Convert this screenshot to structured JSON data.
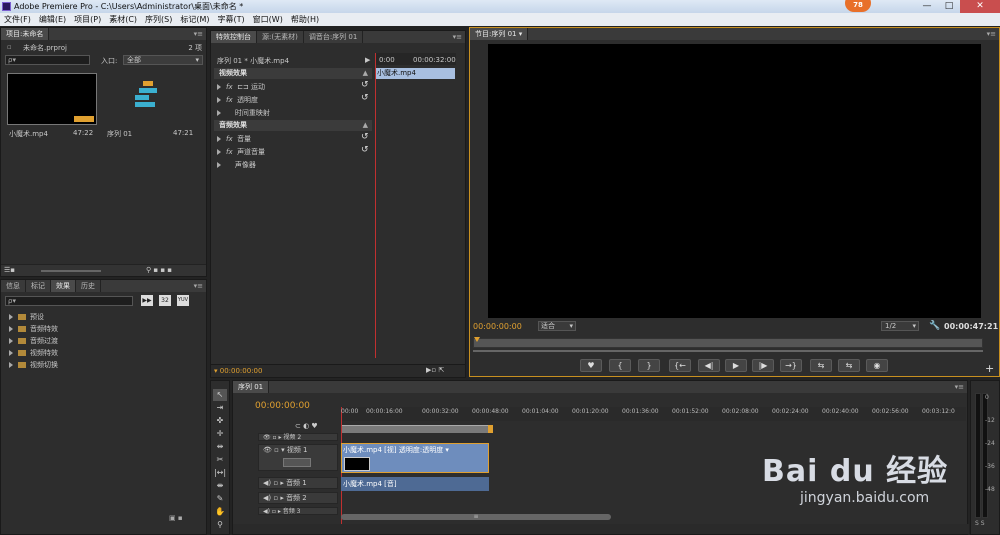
{
  "window": {
    "title": "Adobe Premiere Pro - C:\\Users\\Administrator\\桌面\\未命名 *",
    "badge": "78",
    "minimize": "—",
    "maximize": "□",
    "close": "✕"
  },
  "menu": [
    "文件(F)",
    "编辑(E)",
    "项目(P)",
    "素材(C)",
    "序列(S)",
    "标记(M)",
    "字幕(T)",
    "窗口(W)",
    "帮助(H)"
  ],
  "project": {
    "tab": "项目:未命名",
    "file": "未命名.prproj",
    "count": "2 项",
    "search_prefix": "ρ▾",
    "in_label": "入口:",
    "in_value": "全部",
    "items": [
      {
        "name": "小魔术.mp4",
        "duration": "47:22"
      },
      {
        "name": "序列 01",
        "duration": "47:21"
      }
    ]
  },
  "effects_panel": {
    "tabs": [
      "信息",
      "标记",
      "效果",
      "历史"
    ],
    "btn_32": "32",
    "btn_yuv": "YUV",
    "items": [
      "预设",
      "音频特效",
      "音频过渡",
      "视频特效",
      "视频切换"
    ]
  },
  "effect_controls": {
    "tabs": [
      "特效控制台",
      "源:(无素材)",
      "调音台:序列 01"
    ],
    "sequence": "序列 01 * 小魔术.mp4",
    "time_start": "0:00",
    "time_end": "00:00:32:00",
    "clip": "小魔术.mp4",
    "video_header": "视频效果",
    "video_items": [
      "运动",
      "透明度",
      "时间重映射"
    ],
    "audio_header": "音频效果",
    "audio_items": [
      "音量",
      "声道音量",
      "声像器"
    ],
    "timecode": "00:00:00:00",
    "fx": "fx",
    "reset_glyph": "↺"
  },
  "program": {
    "tab": "节目:序列 01",
    "timecode": "00:00:00:00",
    "fit": "适合",
    "quality": "1/2",
    "duration": "00:00:47:21",
    "controls": [
      "♥",
      "{",
      "}",
      "{←",
      "◀|",
      "▶",
      "|▶",
      "→}",
      "⇆",
      "⇆",
      "◉"
    ],
    "add": "+"
  },
  "timeline": {
    "tab": "序列 01",
    "timecode": "00:00:00:00",
    "ruler": [
      "00:00",
      "00:00:16:00",
      "00:00:32:00",
      "00:00:48:00",
      "00:01:04:00",
      "00:01:20:00",
      "00:01:36:00",
      "00:01:52:00",
      "00:02:08:00",
      "00:02:24:00",
      "00:02:40:00",
      "00:02:56:00",
      "00:03:12:0"
    ],
    "tracks": [
      {
        "label": "视频 2",
        "icons": "👁 ▫"
      },
      {
        "label": "视频 1",
        "icons": "👁 ▫"
      },
      {
        "label": "音频 1",
        "icons": "◀) ▫"
      },
      {
        "label": "音频 2",
        "icons": "◀) ▫"
      },
      {
        "label": "音频 3",
        "icons": "◀) ▫"
      }
    ],
    "video_clip": "小魔术.mp4 [视] 透明度:透明度 ▾",
    "audio_clip": "小魔术.mp4 [音]",
    "scroll": "≡"
  },
  "meter": {
    "labels": [
      "0",
      "-12",
      "-24",
      "-36",
      "-48"
    ],
    "ss": "S S"
  },
  "watermark": {
    "text": "Bai du 经验",
    "url": "jingyan.baidu.com"
  },
  "colors": {
    "accent_orange": "#e0a030",
    "playhead_red": "#c03030",
    "clip_blue": "#5f7fae"
  }
}
